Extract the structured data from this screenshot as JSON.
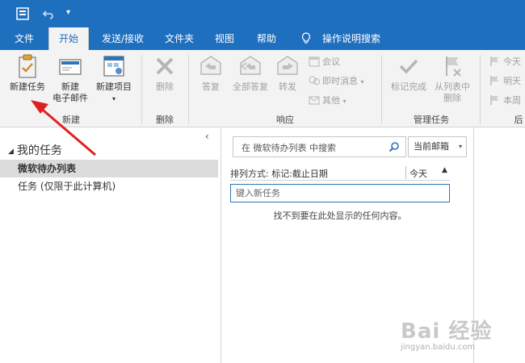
{
  "window": {
    "quick_access": [
      "app-icon",
      "undo-icon",
      "customize-icon"
    ]
  },
  "tabs": [
    {
      "label": "文件"
    },
    {
      "label": "开始"
    },
    {
      "label": "发送/接收"
    },
    {
      "label": "文件夹"
    },
    {
      "label": "视图"
    },
    {
      "label": "帮助"
    },
    {
      "label": "操作说明搜索"
    }
  ],
  "active_tab": "开始",
  "ribbon": {
    "new_group": {
      "label": "新建",
      "new_task": "新建任务",
      "new_email_line1": "新建",
      "new_email_line2": "电子邮件",
      "new_items": "新建项目"
    },
    "delete_group": {
      "label": "删除",
      "delete": "删除"
    },
    "respond_group": {
      "label": "响应",
      "reply": "答复",
      "reply_all": "全部答复",
      "forward": "转发",
      "meeting": "会议",
      "im": "即时消息",
      "more": "其他"
    },
    "manage_group": {
      "label": "管理任务",
      "mark_complete": "标记完成",
      "remove_line1": "从列表中",
      "remove_line2": "删除"
    },
    "followup_group": {
      "label": "后",
      "today": "今天",
      "tomorrow": "明天",
      "this_week": "本周"
    }
  },
  "nav": {
    "section_title": "我的任务",
    "items": [
      {
        "label": "微软待办列表",
        "selected": true
      },
      {
        "label": "任务 (仅限于此计算机)",
        "selected": false
      }
    ],
    "collapse_glyph": "‹"
  },
  "list": {
    "search_placeholder": "在 微软待办列表 中搜索",
    "scope": "当前邮箱",
    "sort_label": "排列方式: 标记:截止日期",
    "sort_value": "今天",
    "new_task_placeholder": "键入新任务",
    "empty_message": "找不到要在此处显示的任何内容。"
  },
  "watermark": {
    "brand": "Bai  经验",
    "url": "jingyan.baidu.com"
  },
  "colors": {
    "accent": "#1f6fbf",
    "annotation_arrow": "#e02020"
  }
}
